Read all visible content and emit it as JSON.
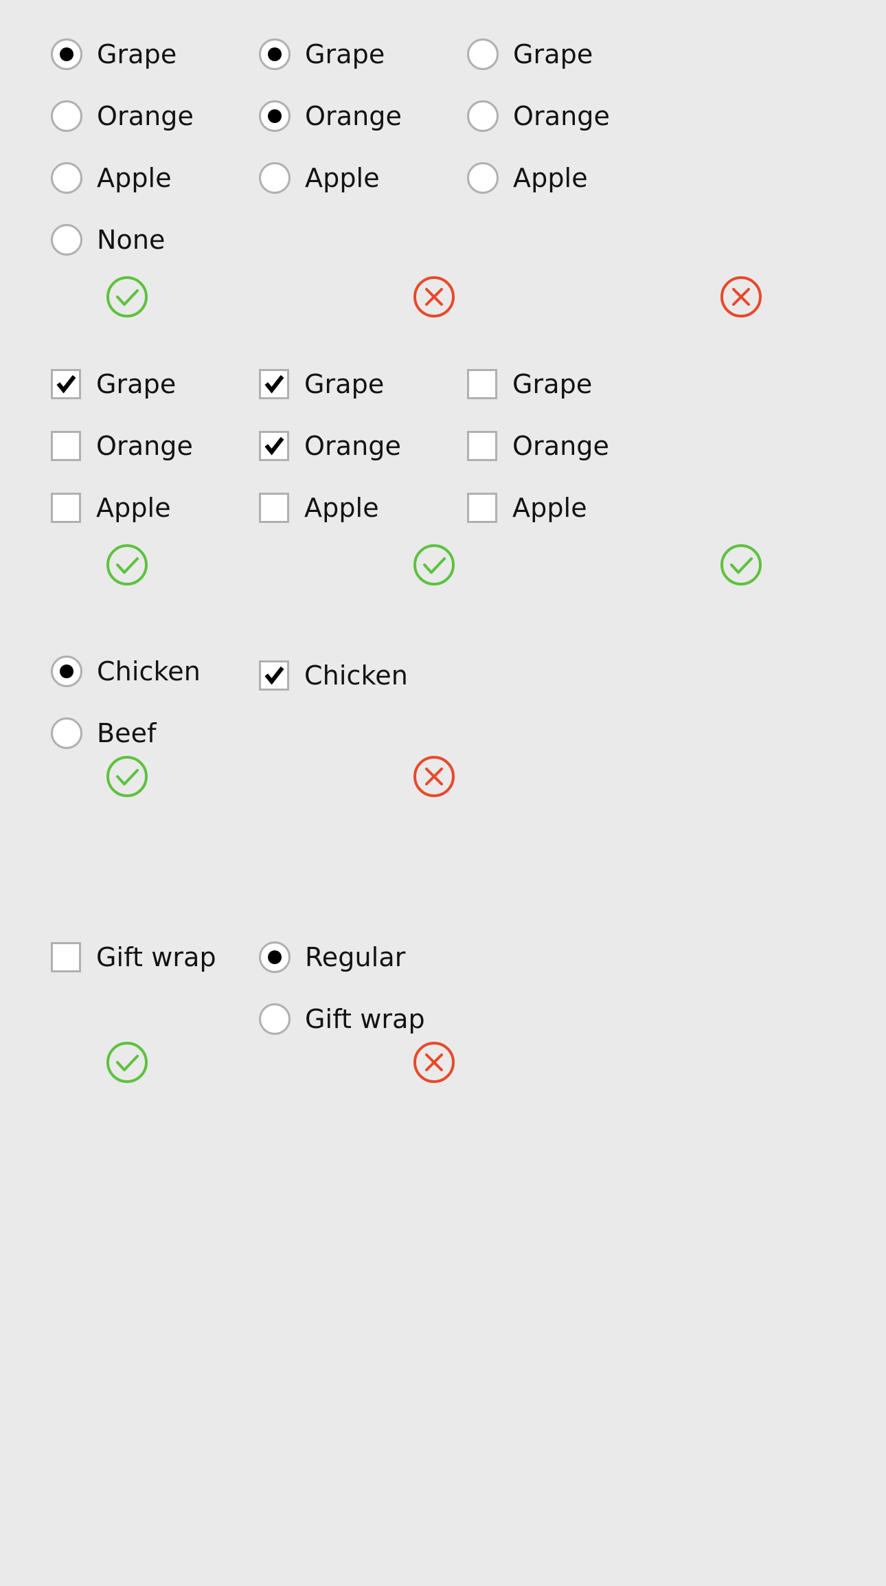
{
  "page": {
    "background_color": "#EAEAEA",
    "valid_color": "#5DC23E",
    "invalid_color": "#E8492B",
    "control_border_color": "#B0B0B0",
    "control_fill_color": "#FFFFFF",
    "label_color": "#121212"
  },
  "icons": {
    "valid": "check-circle-icon",
    "invalid": "x-circle-icon",
    "radio": "radio-button-icon",
    "checkbox": "checkbox-icon"
  },
  "sections": [
    {
      "id": "fruit-radio-section",
      "control_type": "radio",
      "columns": [
        {
          "id": "fruit-radio-valid",
          "status": "valid",
          "status_label": "valid",
          "options": [
            {
              "label": "Grape",
              "selected": true
            },
            {
              "label": "Orange",
              "selected": false
            },
            {
              "label": "Apple",
              "selected": false
            },
            {
              "label": "None",
              "selected": false
            }
          ]
        },
        {
          "id": "fruit-radio-multi-selected",
          "status": "invalid",
          "status_label": "invalid",
          "options": [
            {
              "label": "Grape",
              "selected": true
            },
            {
              "label": "Orange",
              "selected": true
            },
            {
              "label": "Apple",
              "selected": false
            }
          ]
        },
        {
          "id": "fruit-radio-none-selected",
          "status": "invalid",
          "status_label": "invalid",
          "options": [
            {
              "label": "Grape",
              "selected": false
            },
            {
              "label": "Orange",
              "selected": false
            },
            {
              "label": "Apple",
              "selected": false
            }
          ]
        }
      ]
    },
    {
      "id": "fruit-checkbox-section",
      "control_type": "checkbox",
      "columns": [
        {
          "id": "fruit-checkbox-single",
          "status": "valid",
          "status_label": "valid",
          "options": [
            {
              "label": "Grape",
              "selected": true
            },
            {
              "label": "Orange",
              "selected": false
            },
            {
              "label": "Apple",
              "selected": false
            }
          ]
        },
        {
          "id": "fruit-checkbox-multi",
          "status": "valid",
          "status_label": "valid",
          "options": [
            {
              "label": "Grape",
              "selected": true
            },
            {
              "label": "Orange",
              "selected": true
            },
            {
              "label": "Apple",
              "selected": false
            }
          ]
        },
        {
          "id": "fruit-checkbox-none",
          "status": "valid",
          "status_label": "valid",
          "options": [
            {
              "label": "Grape",
              "selected": false
            },
            {
              "label": "Orange",
              "selected": false
            },
            {
              "label": "Apple",
              "selected": false
            }
          ]
        }
      ]
    },
    {
      "id": "meat-section",
      "columns": [
        {
          "id": "meat-radio",
          "control_type": "radio",
          "status": "valid",
          "status_label": "valid",
          "options": [
            {
              "label": "Chicken",
              "selected": true
            },
            {
              "label": "Beef",
              "selected": false
            }
          ]
        },
        {
          "id": "meat-checkbox",
          "control_type": "checkbox",
          "status": "invalid",
          "status_label": "invalid",
          "options": [
            {
              "label": "Chicken",
              "selected": true
            }
          ]
        }
      ]
    },
    {
      "id": "gift-wrap-section",
      "columns": [
        {
          "id": "gift-wrap-checkbox",
          "control_type": "checkbox",
          "status": "valid",
          "status_label": "valid",
          "options": [
            {
              "label": "Gift wrap",
              "selected": false
            }
          ]
        },
        {
          "id": "gift-wrap-radio",
          "control_type": "radio",
          "status": "invalid",
          "status_label": "invalid",
          "options": [
            {
              "label": "Regular",
              "selected": true
            },
            {
              "label": "Gift wrap",
              "selected": false
            }
          ]
        }
      ]
    }
  ]
}
